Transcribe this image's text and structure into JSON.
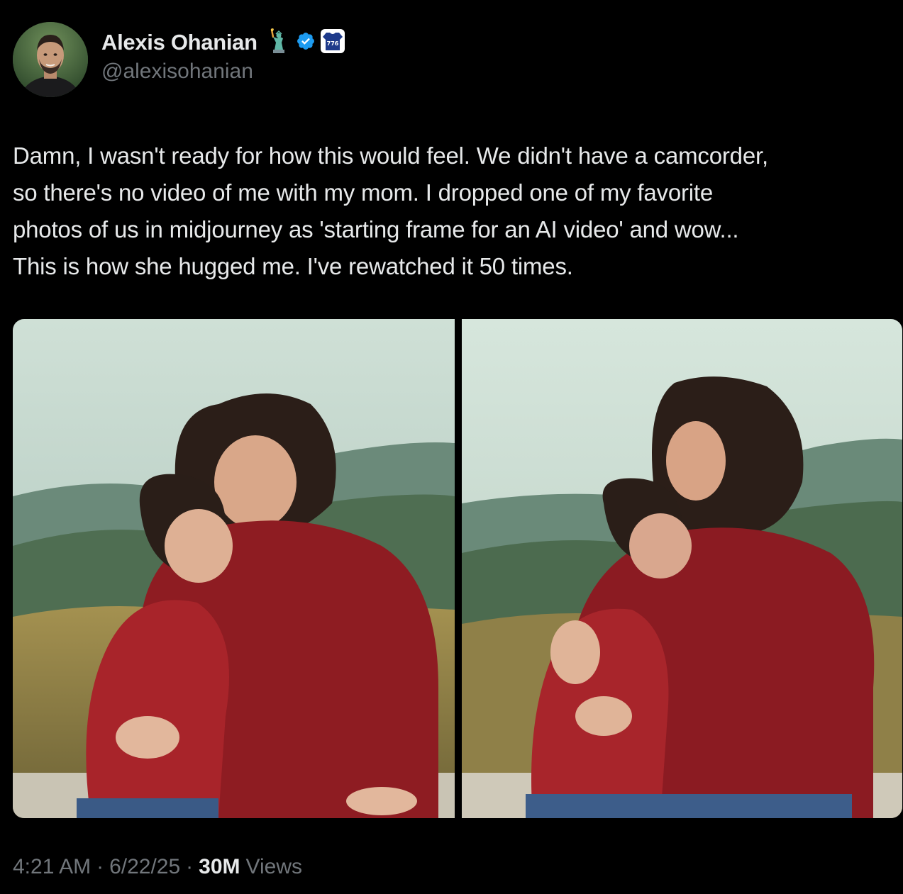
{
  "author": {
    "display_name": "Alexis Ohanian",
    "handle": "@alexisohanian",
    "badge_text": "776",
    "icons": [
      "statue-of-liberty-icon",
      "verified-badge-icon",
      "team-jersey-badge-icon"
    ],
    "verified_color": "#1d9bf0"
  },
  "tweet": {
    "text": "Damn, I wasn't ready for how this would feel. We didn't have a camcorder,\nso there's no video of me with my mom. I dropped one of my favorite\nphotos of us in midjourney as 'starting frame for an AI video' and wow...\nThis is how she hugged me. I've rewatched it 50 times."
  },
  "media": {
    "photos": [
      {
        "label": "original-photo"
      },
      {
        "label": "ai-video-frame"
      }
    ]
  },
  "meta": {
    "time": "4:21 AM",
    "separator": "·",
    "date": "6/22/25",
    "views_count": "30M",
    "views_label": "Views"
  },
  "colors": {
    "background": "#000000",
    "text_primary": "#e7e9ea",
    "text_secondary": "#71767b",
    "accent": "#1d9bf0"
  }
}
